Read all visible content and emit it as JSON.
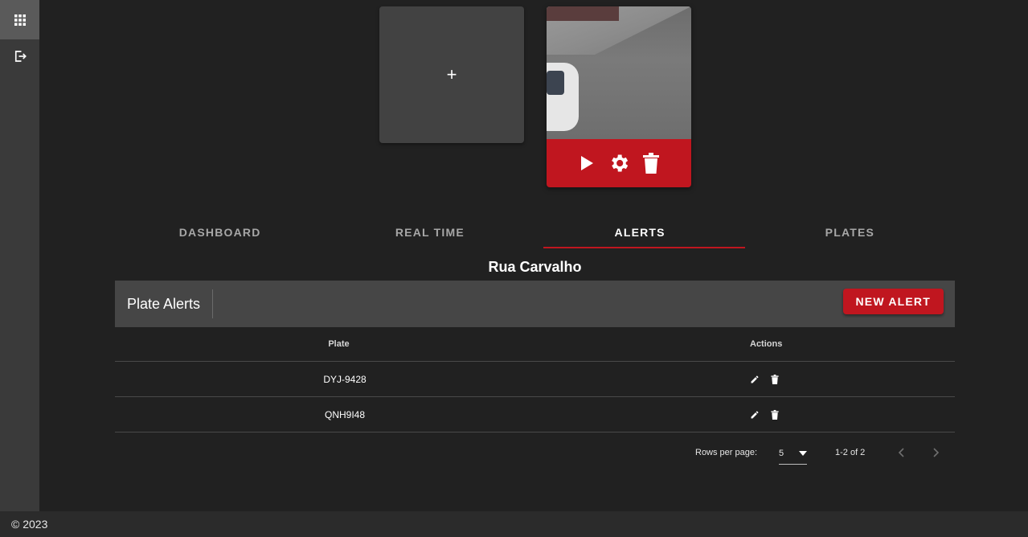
{
  "sidebar": {
    "items": [
      {
        "icon": "apps-grid-icon",
        "active": true
      },
      {
        "icon": "logout-icon",
        "active": false
      }
    ]
  },
  "cameras": {
    "add_label": "+",
    "cards": [
      {
        "actions": [
          "play-icon",
          "gear-icon",
          "trash-icon"
        ]
      }
    ]
  },
  "tabs": [
    {
      "label": "DASHBOARD",
      "active": false
    },
    {
      "label": "REAL TIME",
      "active": false
    },
    {
      "label": "ALERTS",
      "active": true
    },
    {
      "label": "PLATES",
      "active": false
    }
  ],
  "location": {
    "name": "Rua Carvalho"
  },
  "alerts_table": {
    "title": "Plate Alerts",
    "new_button": "NEW ALERT",
    "columns": {
      "plate": "Plate",
      "actions": "Actions"
    },
    "rows": [
      {
        "plate": "DYJ-9428"
      },
      {
        "plate": "QNH9I48"
      }
    ],
    "pagination": {
      "rows_per_page_label": "Rows per page:",
      "rows_per_page_value": "5",
      "range": "1-2 of 2"
    }
  },
  "footer": {
    "copyright": "© 2023"
  },
  "colors": {
    "accent": "#c0161f",
    "background": "#212121",
    "sidebar": "#3a3a3a",
    "toolbar": "#464646"
  }
}
